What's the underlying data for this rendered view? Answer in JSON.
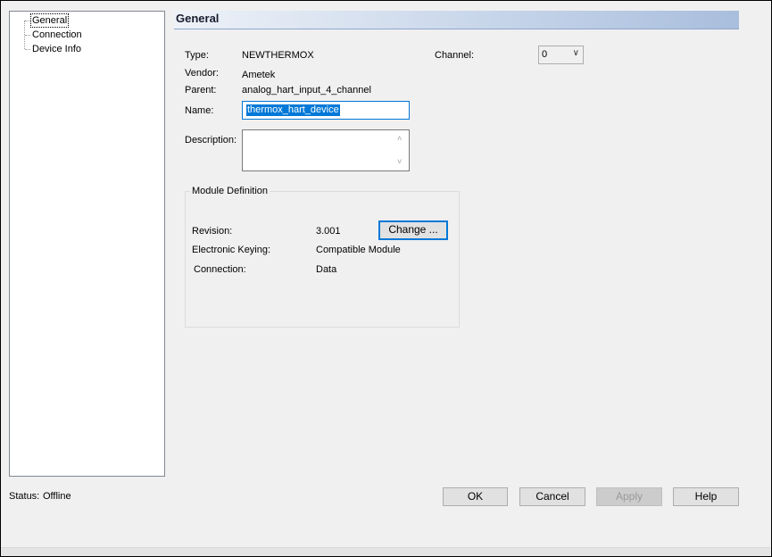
{
  "tree": {
    "items": [
      {
        "label": "General",
        "selected": true
      },
      {
        "label": "Connection",
        "selected": false
      },
      {
        "label": "Device Info",
        "selected": false
      }
    ]
  },
  "section": {
    "title": "General"
  },
  "general": {
    "type_label": "Type:",
    "type_value": "NEWTHERMOX",
    "vendor_label": "Vendor:",
    "vendor_value": "Ametek",
    "parent_label": "Parent:",
    "parent_value": "analog_hart_input_4_channel",
    "name_label": "Name:",
    "name_value": "thermox_hart_device",
    "description_label": "Description:",
    "description_value": "",
    "channel_label": "Channel:",
    "channel_value": "0"
  },
  "module_definition": {
    "title": "Module Definition",
    "revision_label": "Revision:",
    "revision_value": "3.001",
    "change_button": "Change ...",
    "keying_label": "Electronic Keying:",
    "keying_value": "Compatible Module",
    "connection_label": "Connection:",
    "connection_value": "Data"
  },
  "status": {
    "label": "Status:",
    "value": "Offline"
  },
  "buttons": {
    "ok": "OK",
    "cancel": "Cancel",
    "apply": "Apply",
    "help": "Help"
  },
  "colors": {
    "accent": "#0078d7",
    "header_gradient_end": "#a9bedd"
  },
  "icons": {
    "combo_arrow": "chevron-down-icon",
    "scroll_up": "chevron-up-icon",
    "scroll_down": "chevron-down-icon"
  }
}
